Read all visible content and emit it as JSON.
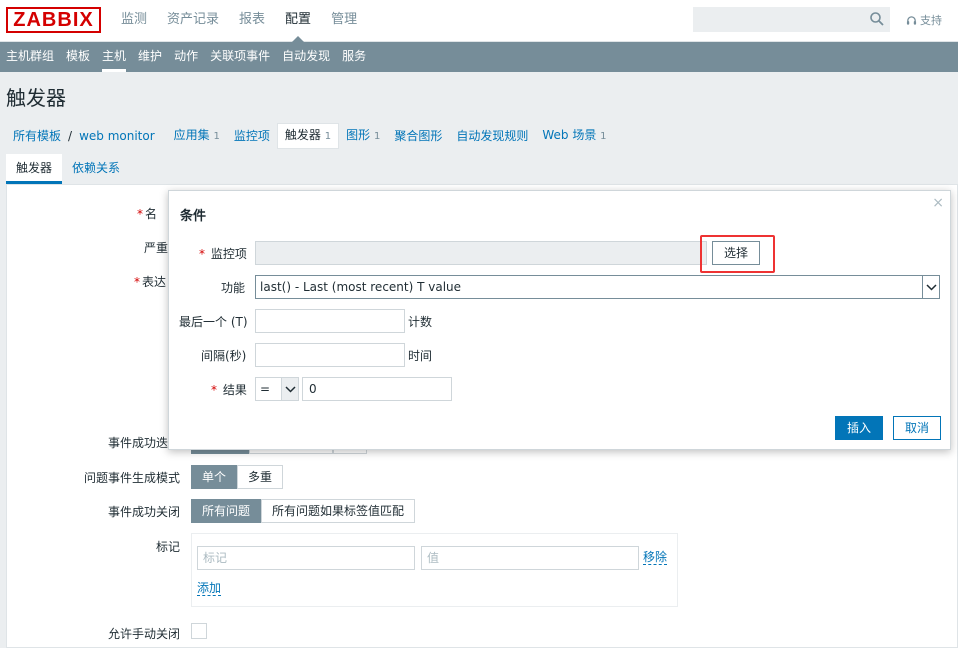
{
  "header": {
    "logo": "ZABBIX",
    "nav": [
      "监测",
      "资产记录",
      "报表",
      "配置",
      "管理"
    ],
    "active_nav": "配置",
    "support": "支持"
  },
  "subnav": {
    "items": [
      "主机群组",
      "模板",
      "主机",
      "维护",
      "动作",
      "关联项事件",
      "自动发现",
      "服务"
    ],
    "active": "主机"
  },
  "page": {
    "title": "触发器",
    "breadcrumb": {
      "all_templates": "所有模板",
      "separator": "/",
      "template": "web monitor",
      "items": [
        {
          "label": "应用集",
          "count": "1"
        },
        {
          "label": "监控项",
          "count": ""
        },
        {
          "label": "触发器",
          "count": "1"
        },
        {
          "label": "图形",
          "count": "1"
        },
        {
          "label": "聚合图形",
          "count": ""
        },
        {
          "label": "自动发现规则",
          "count": ""
        },
        {
          "label": "Web 场景",
          "count": "1"
        }
      ]
    },
    "tabs": [
      "触发器",
      "依赖关系"
    ]
  },
  "form": {
    "name_label": "名",
    "severity_label": "严重",
    "expression_label": "表达",
    "ok_event_label": "事件成功迭",
    "problem_mode_label": "问题事件生成模式",
    "problem_mode_options": [
      "单个",
      "多重"
    ],
    "ok_close_label": "事件成功关闭",
    "ok_close_options": [
      "所有问题",
      "所有问题如果标签值匹配"
    ],
    "tags_label": "标记",
    "tag_placeholder": "标记",
    "value_placeholder": "值",
    "remove_link": "移除",
    "add_link": "添加",
    "manual_close_label": "允许手动关闭"
  },
  "modal": {
    "title": "条件",
    "item_label": "监控项",
    "item_value": "",
    "select_button": "选择",
    "function_label": "功能",
    "function_value": "last() - Last (most recent) T value",
    "last_of_label": "最后一个 (T)",
    "last_of_unit": "计数",
    "interval_label": "间隔(秒)",
    "interval_unit": "时间",
    "result_label": "结果",
    "result_operator": "=",
    "result_value": "0",
    "insert_button": "插入",
    "cancel_button": "取消",
    "close_icon": "×"
  },
  "colors": {
    "brand": "#d40000",
    "nav_bar": "#768d99",
    "link": "#0275b8",
    "highlight": "#e33333"
  }
}
